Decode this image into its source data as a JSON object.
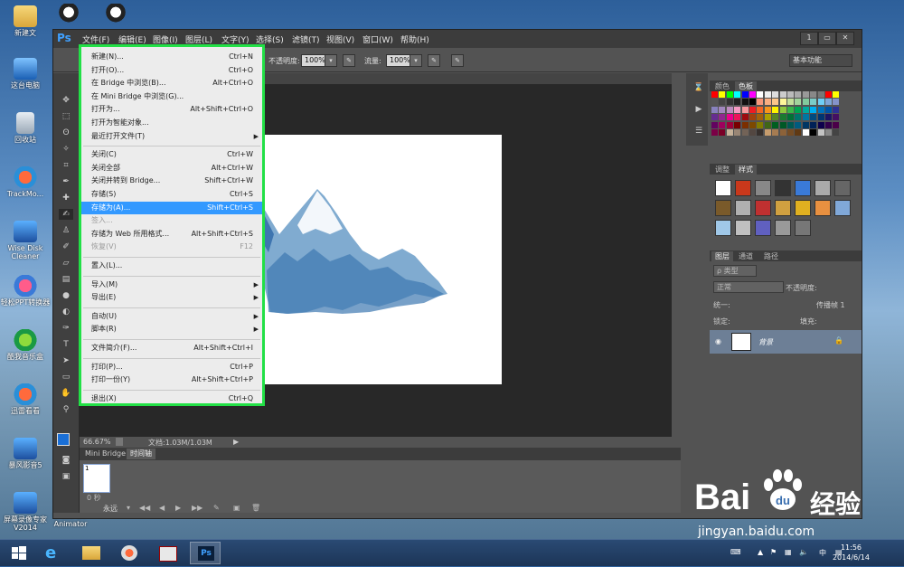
{
  "desktop": {
    "icons": [
      {
        "label": "新建文",
        "kind": "folder"
      },
      {
        "label": "",
        "kind": "qq"
      },
      {
        "label": "",
        "kind": "qq"
      },
      {
        "label": "这台电脑",
        "kind": "pc"
      },
      {
        "label": "回收站",
        "kind": "bin"
      },
      {
        "label": "TrackMo...",
        "kind": "round-red"
      },
      {
        "label": "Wise Disk Cleaner",
        "kind": "blue"
      },
      {
        "label": "轻松PPT转换器",
        "kind": "round-pink"
      },
      {
        "label": "酷我音乐盒",
        "kind": "round-grn"
      },
      {
        "label": "迅雷看看",
        "kind": "round-red"
      },
      {
        "label": "暴风影音5",
        "kind": "blue"
      },
      {
        "label": "屏幕录像专家V2014",
        "kind": "blue"
      },
      {
        "label": "Ulead GIF Animator",
        "kind": "blue"
      }
    ]
  },
  "photoshop": {
    "logo": "Ps",
    "menubar": [
      "文件(F)",
      "编辑(E)",
      "图像(I)",
      "图层(L)",
      "文字(Y)",
      "选择(S)",
      "滤镜(T)",
      "视图(V)",
      "窗口(W)",
      "帮助(H)"
    ],
    "window_buttons": [
      "1",
      "▭",
      "✕"
    ],
    "options": {
      "opacity_label": "不透明度:",
      "opacity_value": "100%",
      "flow_label": "流量:",
      "flow_value": "100%",
      "workspace": "基本功能"
    },
    "status": {
      "zoom": "66.67%",
      "doc_info": "文档:1.03M/1.03M"
    },
    "timeline": {
      "tabs": [
        "Mini Bridge",
        "时间轴"
      ],
      "frame_number": "1",
      "frame_delay": "0 秒",
      "loop": "永远"
    },
    "panels": {
      "color_tabs": [
        "颜色",
        "色板"
      ],
      "adjust_tabs": [
        "调整",
        "样式"
      ],
      "layer_tabs": [
        "图层",
        "通道",
        "路径"
      ],
      "kind_filter": "ρ 类型",
      "blend_mode": "正常",
      "opacity_label": "不透明度:",
      "unify_label": "统一:",
      "propagate_label": "传播帧 1",
      "lock_label": "锁定:",
      "fill_label": "填充:",
      "layer_name": "背景"
    },
    "file_menu": {
      "items": [
        {
          "label": "新建(N)...",
          "shortcut": "Ctrl+N"
        },
        {
          "label": "打开(O)...",
          "shortcut": "Ctrl+O"
        },
        {
          "label": "在 Bridge 中浏览(B)...",
          "shortcut": "Alt+Ctrl+O"
        },
        {
          "label": "在 Mini Bridge 中浏览(G)...",
          "shortcut": ""
        },
        {
          "label": "打开为...",
          "shortcut": "Alt+Shift+Ctrl+O"
        },
        {
          "label": "打开为智能对象...",
          "shortcut": ""
        },
        {
          "label": "最近打开文件(T)",
          "shortcut": "",
          "submenu": true
        },
        {
          "sep": true
        },
        {
          "label": "关闭(C)",
          "shortcut": "Ctrl+W"
        },
        {
          "label": "关闭全部",
          "shortcut": "Alt+Ctrl+W"
        },
        {
          "label": "关闭并转到 Bridge...",
          "shortcut": "Shift+Ctrl+W"
        },
        {
          "label": "存储(S)",
          "shortcut": "Ctrl+S"
        },
        {
          "label": "存储为(A)...",
          "shortcut": "Shift+Ctrl+S",
          "selected": true
        },
        {
          "label": "签入...",
          "shortcut": "",
          "disabled": true
        },
        {
          "label": "存储为 Web 所用格式...",
          "shortcut": "Alt+Shift+Ctrl+S"
        },
        {
          "label": "恢复(V)",
          "shortcut": "F12",
          "disabled": true
        },
        {
          "sep": true
        },
        {
          "label": "置入(L)...",
          "shortcut": ""
        },
        {
          "sep": true
        },
        {
          "label": "导入(M)",
          "shortcut": "",
          "submenu": true
        },
        {
          "label": "导出(E)",
          "shortcut": "",
          "submenu": true
        },
        {
          "sep": true
        },
        {
          "label": "自动(U)",
          "shortcut": "",
          "submenu": true
        },
        {
          "label": "脚本(R)",
          "shortcut": "",
          "submenu": true
        },
        {
          "sep": true
        },
        {
          "label": "文件简介(F)...",
          "shortcut": "Alt+Shift+Ctrl+I"
        },
        {
          "sep": true
        },
        {
          "label": "打印(P)...",
          "shortcut": "Ctrl+P"
        },
        {
          "label": "打印一份(Y)",
          "shortcut": "Alt+Shift+Ctrl+P"
        },
        {
          "sep": true
        },
        {
          "label": "退出(X)",
          "shortcut": "Ctrl+Q"
        }
      ]
    }
  },
  "taskbar": {
    "clock_time": "11:56",
    "clock_date": "2014/6/14",
    "ime": "中",
    "ps_label": "Ps"
  },
  "watermark": {
    "brand": "Bai",
    "brand_cn": "经验",
    "url": "jingyan.baidu.com"
  },
  "colors": {
    "accent_green": "#22e046",
    "menu_selected": "#3399ff",
    "ps_blue": "#3fa0ff"
  }
}
